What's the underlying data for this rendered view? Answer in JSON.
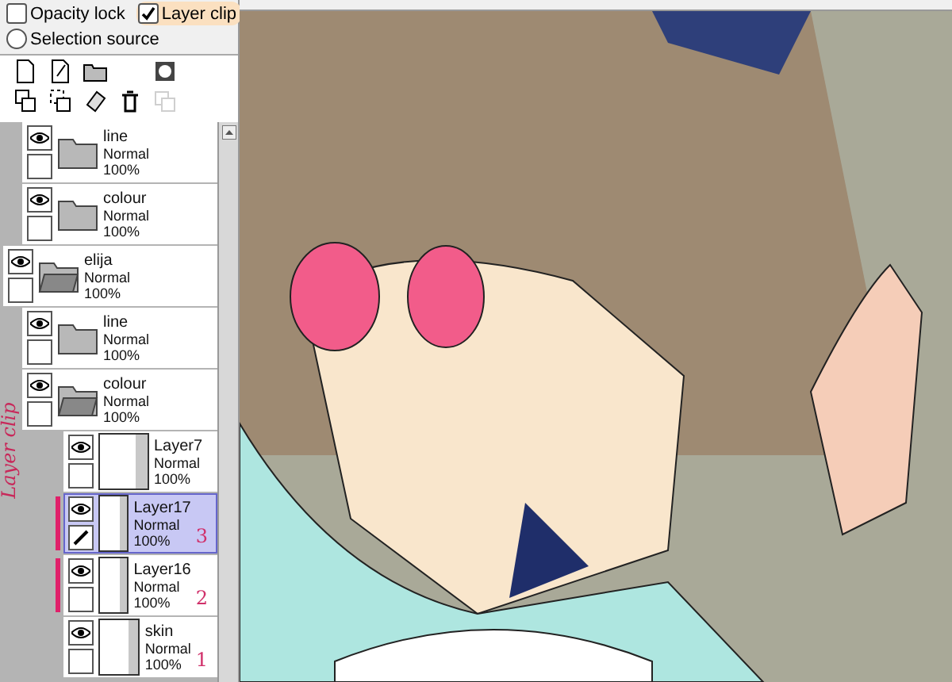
{
  "options": [
    {
      "kind": "checkbox",
      "label": "Opacity lock",
      "checked": false,
      "highlighted": false
    },
    {
      "kind": "checkbox",
      "label": "Layer clip",
      "checked": true,
      "highlighted": true
    },
    {
      "kind": "radio",
      "label": "Selection source",
      "checked": false,
      "highlighted": false
    }
  ],
  "continued_group": {
    "children": [
      {
        "kind": "folder",
        "name": "line",
        "mode": "Normal",
        "opacity": "100%",
        "visible": true,
        "selected": false,
        "clipped": false
      },
      {
        "kind": "folder",
        "name": "colour",
        "mode": "Normal",
        "opacity": "100%",
        "visible": true,
        "selected": false,
        "clipped": false
      }
    ]
  },
  "layers": [
    {
      "kind": "folder",
      "name": "elija",
      "mode": "Normal",
      "opacity": "100%",
      "visible": true,
      "selected": false,
      "clipped": false,
      "expanded": true,
      "children": [
        {
          "kind": "folder",
          "name": "line",
          "mode": "Normal",
          "opacity": "100%",
          "visible": true,
          "selected": false,
          "clipped": false
        },
        {
          "kind": "folder",
          "name": "colour",
          "mode": "Normal",
          "opacity": "100%",
          "visible": true,
          "selected": false,
          "clipped": false,
          "expanded": true,
          "children": [
            {
              "kind": "layer",
              "name": "Layer7",
              "mode": "Normal",
              "opacity": "100%",
              "visible": true,
              "selected": false,
              "clipped": false
            },
            {
              "kind": "layer",
              "name": "Layer17",
              "mode": "Normal",
              "opacity": "100%",
              "visible": true,
              "selected": true,
              "clipped": true,
              "note": "3"
            },
            {
              "kind": "layer",
              "name": "Layer16",
              "mode": "Normal",
              "opacity": "100%",
              "visible": true,
              "selected": false,
              "clipped": true,
              "note": "2"
            },
            {
              "kind": "layer",
              "name": "skin",
              "mode": "Normal",
              "opacity": "100%",
              "visible": true,
              "selected": false,
              "clipped": false,
              "note": "1"
            }
          ]
        }
      ]
    }
  ],
  "handwritten_label": "Layer clip"
}
